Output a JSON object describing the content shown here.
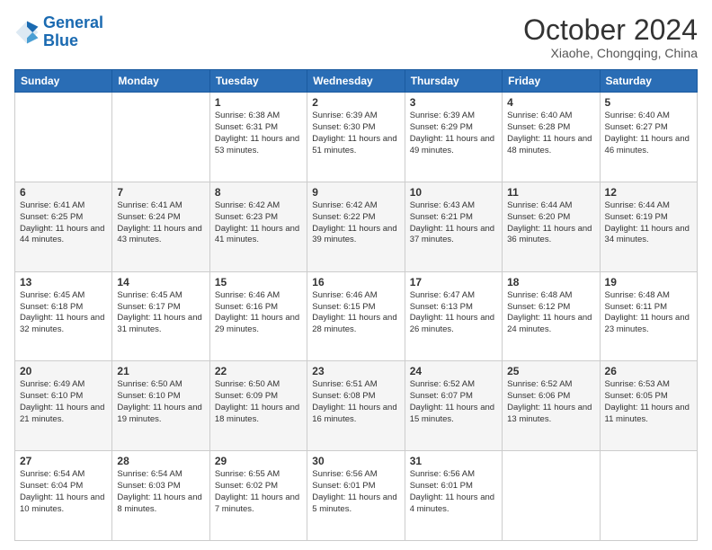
{
  "header": {
    "logo_line1": "General",
    "logo_line2": "Blue",
    "title": "October 2024",
    "subtitle": "Xiaohe, Chongqing, China"
  },
  "days_of_week": [
    "Sunday",
    "Monday",
    "Tuesday",
    "Wednesday",
    "Thursday",
    "Friday",
    "Saturday"
  ],
  "weeks": [
    [
      {
        "day": "",
        "sunrise": "",
        "sunset": "",
        "daylight": ""
      },
      {
        "day": "",
        "sunrise": "",
        "sunset": "",
        "daylight": ""
      },
      {
        "day": "1",
        "sunrise": "Sunrise: 6:38 AM",
        "sunset": "Sunset: 6:31 PM",
        "daylight": "Daylight: 11 hours and 53 minutes."
      },
      {
        "day": "2",
        "sunrise": "Sunrise: 6:39 AM",
        "sunset": "Sunset: 6:30 PM",
        "daylight": "Daylight: 11 hours and 51 minutes."
      },
      {
        "day": "3",
        "sunrise": "Sunrise: 6:39 AM",
        "sunset": "Sunset: 6:29 PM",
        "daylight": "Daylight: 11 hours and 49 minutes."
      },
      {
        "day": "4",
        "sunrise": "Sunrise: 6:40 AM",
        "sunset": "Sunset: 6:28 PM",
        "daylight": "Daylight: 11 hours and 48 minutes."
      },
      {
        "day": "5",
        "sunrise": "Sunrise: 6:40 AM",
        "sunset": "Sunset: 6:27 PM",
        "daylight": "Daylight: 11 hours and 46 minutes."
      }
    ],
    [
      {
        "day": "6",
        "sunrise": "Sunrise: 6:41 AM",
        "sunset": "Sunset: 6:25 PM",
        "daylight": "Daylight: 11 hours and 44 minutes."
      },
      {
        "day": "7",
        "sunrise": "Sunrise: 6:41 AM",
        "sunset": "Sunset: 6:24 PM",
        "daylight": "Daylight: 11 hours and 43 minutes."
      },
      {
        "day": "8",
        "sunrise": "Sunrise: 6:42 AM",
        "sunset": "Sunset: 6:23 PM",
        "daylight": "Daylight: 11 hours and 41 minutes."
      },
      {
        "day": "9",
        "sunrise": "Sunrise: 6:42 AM",
        "sunset": "Sunset: 6:22 PM",
        "daylight": "Daylight: 11 hours and 39 minutes."
      },
      {
        "day": "10",
        "sunrise": "Sunrise: 6:43 AM",
        "sunset": "Sunset: 6:21 PM",
        "daylight": "Daylight: 11 hours and 37 minutes."
      },
      {
        "day": "11",
        "sunrise": "Sunrise: 6:44 AM",
        "sunset": "Sunset: 6:20 PM",
        "daylight": "Daylight: 11 hours and 36 minutes."
      },
      {
        "day": "12",
        "sunrise": "Sunrise: 6:44 AM",
        "sunset": "Sunset: 6:19 PM",
        "daylight": "Daylight: 11 hours and 34 minutes."
      }
    ],
    [
      {
        "day": "13",
        "sunrise": "Sunrise: 6:45 AM",
        "sunset": "Sunset: 6:18 PM",
        "daylight": "Daylight: 11 hours and 32 minutes."
      },
      {
        "day": "14",
        "sunrise": "Sunrise: 6:45 AM",
        "sunset": "Sunset: 6:17 PM",
        "daylight": "Daylight: 11 hours and 31 minutes."
      },
      {
        "day": "15",
        "sunrise": "Sunrise: 6:46 AM",
        "sunset": "Sunset: 6:16 PM",
        "daylight": "Daylight: 11 hours and 29 minutes."
      },
      {
        "day": "16",
        "sunrise": "Sunrise: 6:46 AM",
        "sunset": "Sunset: 6:15 PM",
        "daylight": "Daylight: 11 hours and 28 minutes."
      },
      {
        "day": "17",
        "sunrise": "Sunrise: 6:47 AM",
        "sunset": "Sunset: 6:13 PM",
        "daylight": "Daylight: 11 hours and 26 minutes."
      },
      {
        "day": "18",
        "sunrise": "Sunrise: 6:48 AM",
        "sunset": "Sunset: 6:12 PM",
        "daylight": "Daylight: 11 hours and 24 minutes."
      },
      {
        "day": "19",
        "sunrise": "Sunrise: 6:48 AM",
        "sunset": "Sunset: 6:11 PM",
        "daylight": "Daylight: 11 hours and 23 minutes."
      }
    ],
    [
      {
        "day": "20",
        "sunrise": "Sunrise: 6:49 AM",
        "sunset": "Sunset: 6:10 PM",
        "daylight": "Daylight: 11 hours and 21 minutes."
      },
      {
        "day": "21",
        "sunrise": "Sunrise: 6:50 AM",
        "sunset": "Sunset: 6:10 PM",
        "daylight": "Daylight: 11 hours and 19 minutes."
      },
      {
        "day": "22",
        "sunrise": "Sunrise: 6:50 AM",
        "sunset": "Sunset: 6:09 PM",
        "daylight": "Daylight: 11 hours and 18 minutes."
      },
      {
        "day": "23",
        "sunrise": "Sunrise: 6:51 AM",
        "sunset": "Sunset: 6:08 PM",
        "daylight": "Daylight: 11 hours and 16 minutes."
      },
      {
        "day": "24",
        "sunrise": "Sunrise: 6:52 AM",
        "sunset": "Sunset: 6:07 PM",
        "daylight": "Daylight: 11 hours and 15 minutes."
      },
      {
        "day": "25",
        "sunrise": "Sunrise: 6:52 AM",
        "sunset": "Sunset: 6:06 PM",
        "daylight": "Daylight: 11 hours and 13 minutes."
      },
      {
        "day": "26",
        "sunrise": "Sunrise: 6:53 AM",
        "sunset": "Sunset: 6:05 PM",
        "daylight": "Daylight: 11 hours and 11 minutes."
      }
    ],
    [
      {
        "day": "27",
        "sunrise": "Sunrise: 6:54 AM",
        "sunset": "Sunset: 6:04 PM",
        "daylight": "Daylight: 11 hours and 10 minutes."
      },
      {
        "day": "28",
        "sunrise": "Sunrise: 6:54 AM",
        "sunset": "Sunset: 6:03 PM",
        "daylight": "Daylight: 11 hours and 8 minutes."
      },
      {
        "day": "29",
        "sunrise": "Sunrise: 6:55 AM",
        "sunset": "Sunset: 6:02 PM",
        "daylight": "Daylight: 11 hours and 7 minutes."
      },
      {
        "day": "30",
        "sunrise": "Sunrise: 6:56 AM",
        "sunset": "Sunset: 6:01 PM",
        "daylight": "Daylight: 11 hours and 5 minutes."
      },
      {
        "day": "31",
        "sunrise": "Sunrise: 6:56 AM",
        "sunset": "Sunset: 6:01 PM",
        "daylight": "Daylight: 11 hours and 4 minutes."
      },
      {
        "day": "",
        "sunrise": "",
        "sunset": "",
        "daylight": ""
      },
      {
        "day": "",
        "sunrise": "",
        "sunset": "",
        "daylight": ""
      }
    ]
  ]
}
